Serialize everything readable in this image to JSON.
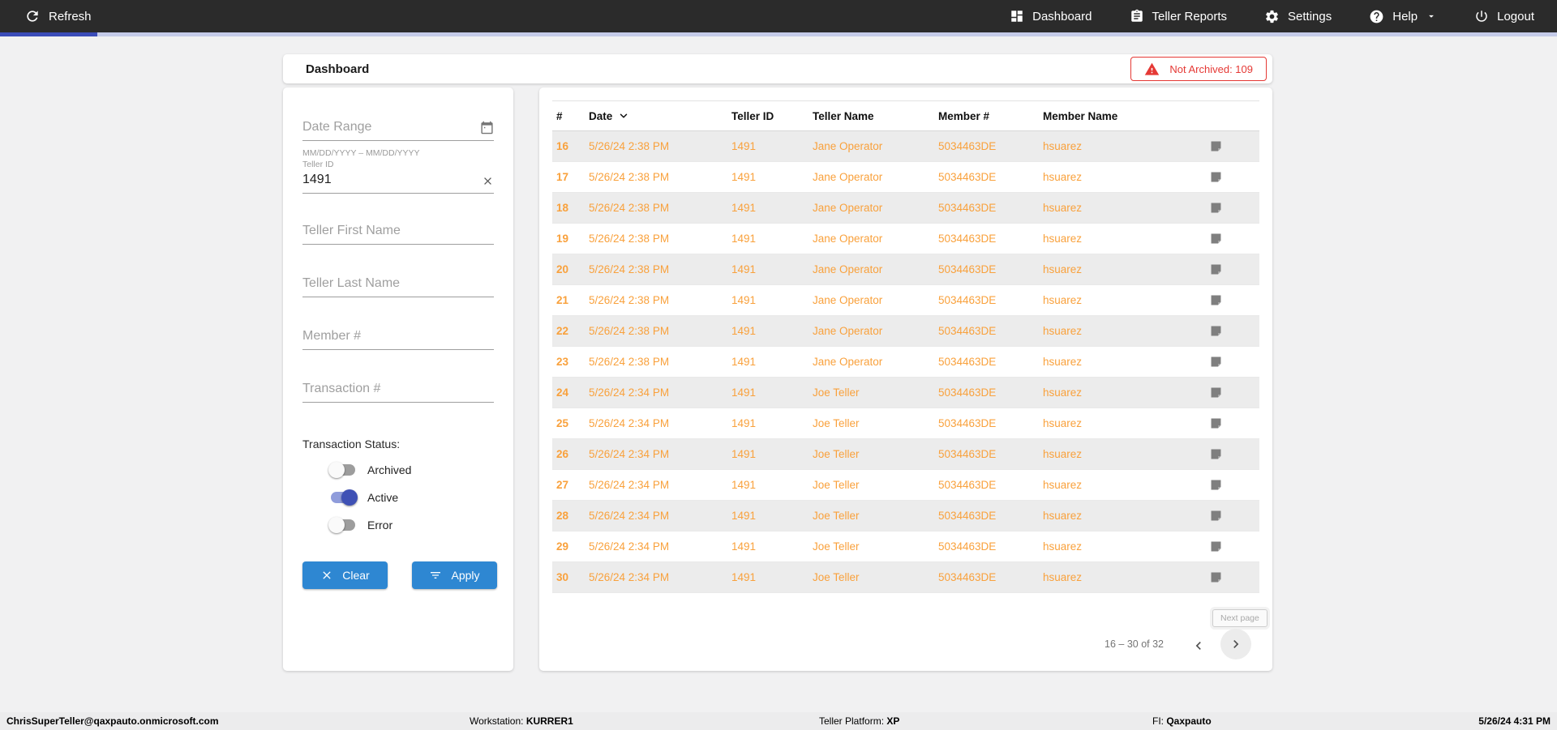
{
  "navbar": {
    "refresh_label": "Refresh",
    "items": [
      {
        "label": "Dashboard"
      },
      {
        "label": "Teller Reports"
      },
      {
        "label": "Settings"
      },
      {
        "label": "Help"
      },
      {
        "label": "Logout"
      }
    ]
  },
  "progress": {
    "fill_color": "#3B4CB8",
    "track_color": "#C5CBE9",
    "fill_fraction": 0.0625
  },
  "header": {
    "title": "Dashboard",
    "not_archived_badge": "Not Archived: 109",
    "badge_color": "#E53935"
  },
  "filters": {
    "date_range": {
      "placeholder": "Date Range",
      "helper": "MM/DD/YYYY – MM/DD/YYYY",
      "value": ""
    },
    "teller_id": {
      "label": "Teller ID",
      "value": "1491"
    },
    "text_fields": [
      {
        "placeholder": "Teller First Name",
        "value": ""
      },
      {
        "placeholder": "Teller Last Name",
        "value": ""
      },
      {
        "placeholder": "Member #",
        "value": ""
      },
      {
        "placeholder": "Transaction #",
        "value": ""
      }
    ],
    "status": {
      "label": "Transaction Status:",
      "toggles": [
        {
          "label": "Archived",
          "on": false
        },
        {
          "label": "Active",
          "on": true
        },
        {
          "label": "Error",
          "on": false
        }
      ]
    },
    "clear_label": "Clear",
    "apply_label": "Apply",
    "button_color": "#2E87D2"
  },
  "table": {
    "columns": [
      "#",
      "Date",
      "Teller ID",
      "Teller Name",
      "Member #",
      "Member Name"
    ],
    "sorted_by": "Date",
    "row_text_color": "#F9A13C",
    "rows": [
      {
        "num": "16",
        "date": "5/26/24 2:38 PM",
        "teller_id": "1491",
        "teller_name": "Jane Operator",
        "member_num": "5034463DE",
        "member_name": "hsuarez"
      },
      {
        "num": "17",
        "date": "5/26/24 2:38 PM",
        "teller_id": "1491",
        "teller_name": "Jane Operator",
        "member_num": "5034463DE",
        "member_name": "hsuarez"
      },
      {
        "num": "18",
        "date": "5/26/24 2:38 PM",
        "teller_id": "1491",
        "teller_name": "Jane Operator",
        "member_num": "5034463DE",
        "member_name": "hsuarez"
      },
      {
        "num": "19",
        "date": "5/26/24 2:38 PM",
        "teller_id": "1491",
        "teller_name": "Jane Operator",
        "member_num": "5034463DE",
        "member_name": "hsuarez"
      },
      {
        "num": "20",
        "date": "5/26/24 2:38 PM",
        "teller_id": "1491",
        "teller_name": "Jane Operator",
        "member_num": "5034463DE",
        "member_name": "hsuarez"
      },
      {
        "num": "21",
        "date": "5/26/24 2:38 PM",
        "teller_id": "1491",
        "teller_name": "Jane Operator",
        "member_num": "5034463DE",
        "member_name": "hsuarez"
      },
      {
        "num": "22",
        "date": "5/26/24 2:38 PM",
        "teller_id": "1491",
        "teller_name": "Jane Operator",
        "member_num": "5034463DE",
        "member_name": "hsuarez"
      },
      {
        "num": "23",
        "date": "5/26/24 2:38 PM",
        "teller_id": "1491",
        "teller_name": "Jane Operator",
        "member_num": "5034463DE",
        "member_name": "hsuarez"
      },
      {
        "num": "24",
        "date": "5/26/24 2:34 PM",
        "teller_id": "1491",
        "teller_name": "Joe Teller",
        "member_num": "5034463DE",
        "member_name": "hsuarez"
      },
      {
        "num": "25",
        "date": "5/26/24 2:34 PM",
        "teller_id": "1491",
        "teller_name": "Joe Teller",
        "member_num": "5034463DE",
        "member_name": "hsuarez"
      },
      {
        "num": "26",
        "date": "5/26/24 2:34 PM",
        "teller_id": "1491",
        "teller_name": "Joe Teller",
        "member_num": "5034463DE",
        "member_name": "hsuarez"
      },
      {
        "num": "27",
        "date": "5/26/24 2:34 PM",
        "teller_id": "1491",
        "teller_name": "Joe Teller",
        "member_num": "5034463DE",
        "member_name": "hsuarez"
      },
      {
        "num": "28",
        "date": "5/26/24 2:34 PM",
        "teller_id": "1491",
        "teller_name": "Joe Teller",
        "member_num": "5034463DE",
        "member_name": "hsuarez"
      },
      {
        "num": "29",
        "date": "5/26/24 2:34 PM",
        "teller_id": "1491",
        "teller_name": "Joe Teller",
        "member_num": "5034463DE",
        "member_name": "hsuarez"
      },
      {
        "num": "30",
        "date": "5/26/24 2:34 PM",
        "teller_id": "1491",
        "teller_name": "Joe Teller",
        "member_num": "5034463DE",
        "member_name": "hsuarez"
      }
    ],
    "pagination": {
      "range_label": "16 – 30 of 32",
      "next_tooltip": "Next page"
    }
  },
  "footer": {
    "user": "ChrisSuperTeller@qaxpauto.onmicrosoft.com",
    "workstation_label": "Workstation:",
    "workstation_value": "KURRER1",
    "platform_label": "Teller Platform:",
    "platform_value": "XP",
    "fi_label": "FI:",
    "fi_value": "Qaxpauto",
    "datetime": "5/26/24 4:31 PM"
  }
}
